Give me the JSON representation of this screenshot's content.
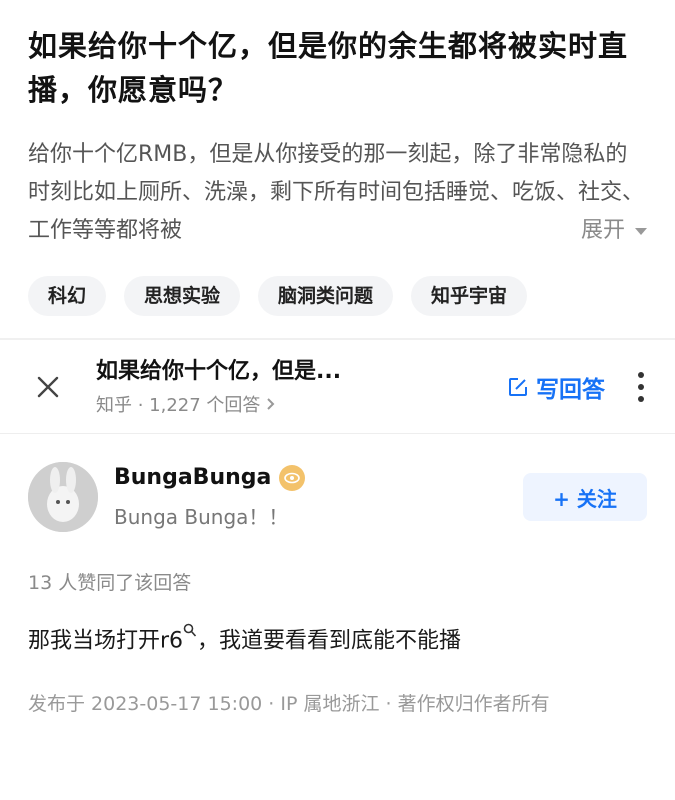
{
  "question": {
    "title": "如果给你十个亿，但是你的余生都将被实时直播，你愿意吗？",
    "description": "给你十个亿RMB，但是从你接受的那一刻起，除了非常隐私的时刻比如上厕所、洗澡，剩下所有时间包括睡觉、吃饭、社交、工作等等都将被",
    "expand_label": "展开",
    "tags": [
      "科幻",
      "思想实验",
      "脑洞类问题",
      "知乎宇宙"
    ]
  },
  "topbar": {
    "title": "如果给你十个亿，但是...",
    "subtitle": "知乎 · 1,227 个回答",
    "write_label": "写回答"
  },
  "author": {
    "name": "BungaBunga",
    "bio": "Bunga Bunga！！",
    "follow_label": "+ 关注"
  },
  "answer": {
    "likes": "13 人赞同了该回答",
    "text": "那我当场打开r6",
    "text_after": "，我道要看看到底能不能播",
    "meta": "发布于 2023-05-17 15:00 · IP 属地浙江 · 著作权归作者所有"
  },
  "colors": {
    "accent": "#1772f6",
    "muted": "#8a8a8a"
  }
}
